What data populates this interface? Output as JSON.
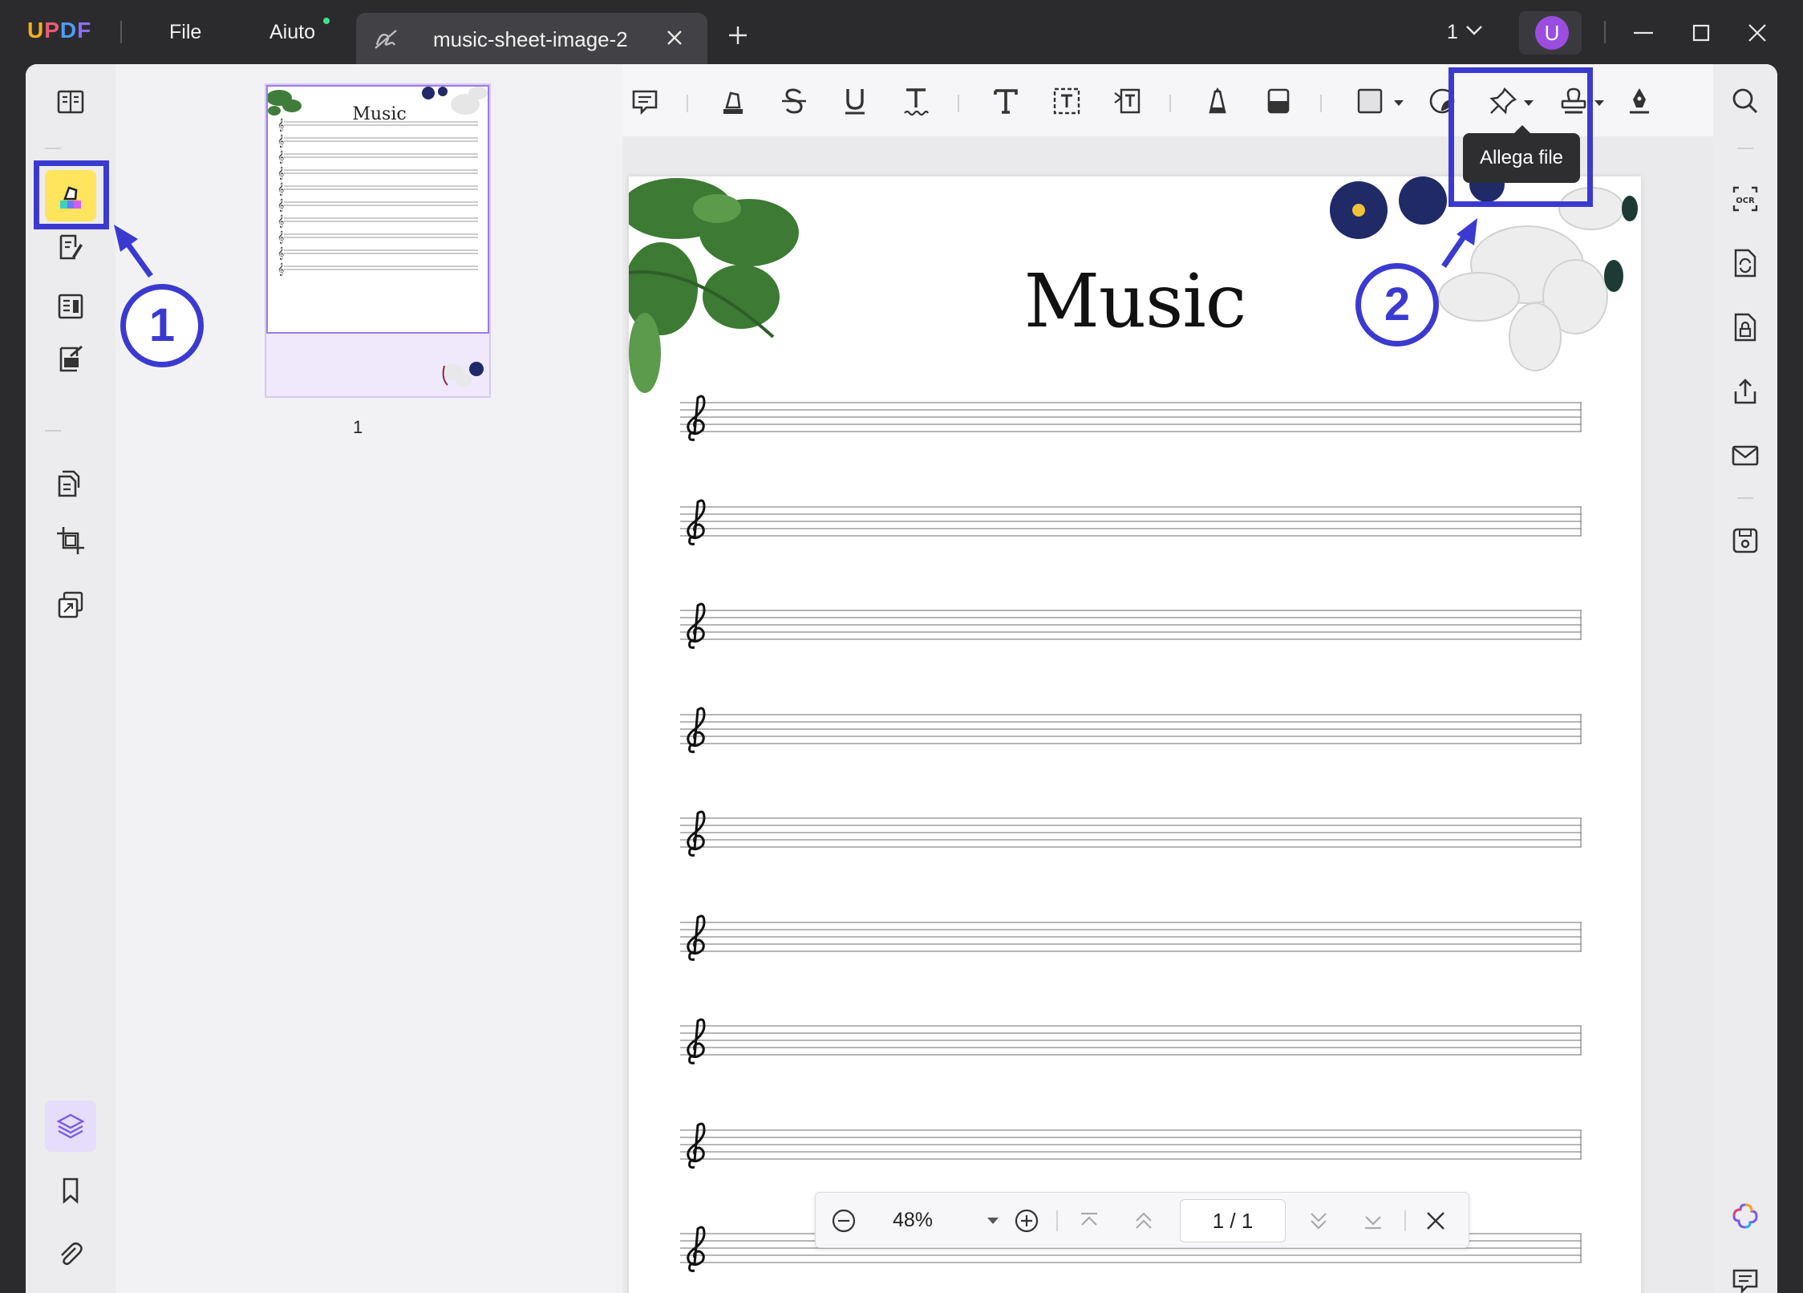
{
  "app": {
    "logo": "UPDF",
    "menu": [
      {
        "label": "File"
      },
      {
        "label": "Aiuto"
      }
    ],
    "tab": {
      "title": "music-sheet-image-2"
    },
    "page_indicator": "1",
    "user_initial": "U"
  },
  "left_rail": {
    "items": [
      "reader-icon",
      "comment-icon",
      "edit-pdf-icon",
      "form-icon",
      "fill-sign-icon",
      "organize-pages-icon",
      "crop-icon",
      "compress-icon",
      "layers-icon",
      "bookmark-icon",
      "attachment-icon"
    ],
    "active": "comment-icon"
  },
  "thumbnails": {
    "pages": [
      {
        "title": "Music",
        "number": "1"
      }
    ]
  },
  "toolbar": {
    "items": [
      "sticky-note-icon",
      "highlight-icon",
      "strikethrough-icon",
      "underline-icon",
      "squiggly-icon",
      "text-icon",
      "text-box-icon",
      "text-callout-icon",
      "pencil-icon",
      "eraser-icon",
      "shape-icon",
      "sticker-icon",
      "attach-file-icon",
      "stamp-icon",
      "signature-icon"
    ],
    "tooltip": "Allega file"
  },
  "right_rail": {
    "items": [
      "search-icon",
      "ocr-icon",
      "convert-icon",
      "protect-icon",
      "share-icon",
      "email-icon",
      "save-icon",
      "ai-icon",
      "chat-icon"
    ]
  },
  "page": {
    "title": "Music",
    "staff_count": 9
  },
  "annotations": {
    "step1": "1",
    "step2": "2",
    "colors": {
      "highlight": "#3b3ad0"
    }
  },
  "navbar": {
    "zoom": "48%",
    "page_current": "1",
    "page_total": "1",
    "page_label": "1 / 1"
  }
}
